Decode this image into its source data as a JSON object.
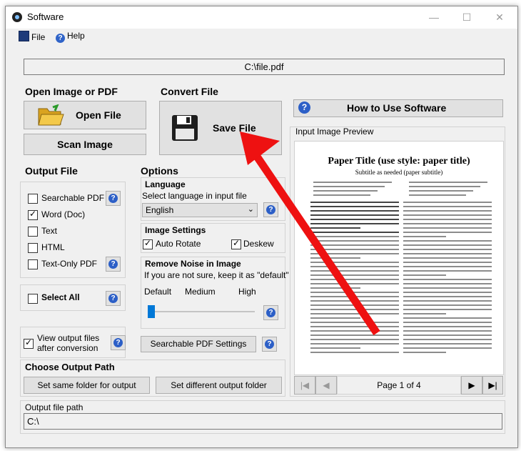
{
  "window": {
    "title": "Software"
  },
  "menu": {
    "file": "File",
    "help": "Help"
  },
  "file_path_display": "C:\\file.pdf",
  "open_group": {
    "title": "Open Image or PDF",
    "open_file": "Open File",
    "scan_image": "Scan Image"
  },
  "convert_group": {
    "title": "Convert File",
    "save_file": "Save File"
  },
  "how_to": {
    "label": "How to Use Software"
  },
  "output_file": {
    "title": "Output File",
    "options": [
      {
        "label": "Searchable PDF",
        "checked": false
      },
      {
        "label": "Word (Doc)",
        "checked": true
      },
      {
        "label": "Text",
        "checked": false
      },
      {
        "label": "HTML",
        "checked": false
      },
      {
        "label": "Text-Only PDF",
        "checked": false
      }
    ],
    "select_all": "Select All"
  },
  "options": {
    "title": "Options",
    "language": {
      "title": "Language",
      "hint": "Select language in input file",
      "selected": "English"
    },
    "image_settings": {
      "title": "Image Settings",
      "auto_rotate": "Auto Rotate",
      "deskew": "Deskew",
      "auto_rotate_checked": true,
      "deskew_checked": true
    },
    "noise": {
      "title": "Remove Noise in Image",
      "hint": "If you are not sure, keep it as \"default\"",
      "levels": [
        "Default",
        "Medium",
        "High"
      ],
      "value_index": 0
    },
    "searchable_settings": "Searchable PDF Settings"
  },
  "view_after": {
    "label_line1": "View output files",
    "label_line2": "after conversion",
    "checked": true
  },
  "output_path": {
    "title": "Choose Output Path",
    "same_folder": "Set same folder for output",
    "different_folder": "Set different output folder",
    "field_label": "Output file path",
    "value": "C:\\"
  },
  "preview": {
    "title": "Input Image Preview",
    "doc_title": "Paper Title (use style: paper title)",
    "doc_subtitle": "Subtitle as needed (paper subtitle)",
    "page_indicator": "Page 1 of 4"
  },
  "colors": {
    "accent_blue": "#2c5fc7",
    "arrow_red": "#ee1111",
    "window_bg": "#f0f0f0"
  },
  "icons": [
    "app-icon",
    "floppy-icon",
    "help-icon",
    "folder-icon",
    "first-page-icon",
    "prev-page-icon",
    "next-page-icon",
    "last-page-icon"
  ]
}
